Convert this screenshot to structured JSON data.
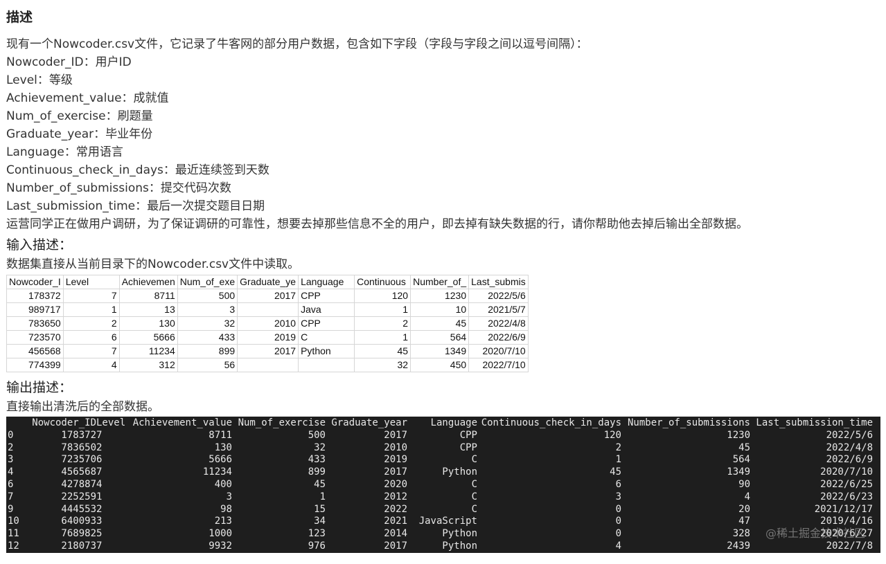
{
  "title": "描述",
  "intro": "现有一个Nowcoder.csv文件，它记录了牛客网的部分用户数据，包含如下字段（字段与字段之间以逗号间隔）：",
  "fields": [
    "Nowcoder_ID：用户ID",
    "Level：等级",
    "Achievement_value：成就值",
    "Num_of_exercise：刷题量",
    "Graduate_year：毕业年份",
    "Language：常用语言",
    "Continuous_check_in_days：最近连续签到天数",
    "Number_of_submissions：提交代码次数",
    "Last_submission_time：最后一次提交题目日期"
  ],
  "task": "运营同学正在做用户调研，为了保证调研的可靠性，想要去掉那些信息不全的用户，即去掉有缺失数据的行，请你帮助他去掉后输出全部数据。",
  "input_heading": "输入描述：",
  "input_desc": "数据集直接从当前目录下的Nowcoder.csv文件中读取。",
  "input_table": {
    "headers": [
      "Nowcoder_I",
      "Level",
      "Achievemen",
      "Num_of_exe",
      "Graduate_ye",
      "Language",
      "Continuous",
      "Number_of_",
      "Last_submis"
    ],
    "rows": [
      [
        "178372",
        "7",
        "8711",
        "500",
        "2017",
        "CPP",
        "120",
        "1230",
        "2022/5/6"
      ],
      [
        "989717",
        "1",
        "13",
        "3",
        "",
        "Java",
        "1",
        "10",
        "2021/5/7"
      ],
      [
        "783650",
        "2",
        "130",
        "32",
        "2010",
        "CPP",
        "2",
        "45",
        "2022/4/8"
      ],
      [
        "723570",
        "6",
        "5666",
        "433",
        "2019",
        "C",
        "1",
        "564",
        "2022/6/9"
      ],
      [
        "456568",
        "7",
        "11234",
        "899",
        "2017",
        "Python",
        "45",
        "1349",
        "2020/7/10"
      ],
      [
        "774399",
        "4",
        "312",
        "56",
        "",
        "",
        "32",
        "450",
        "2022/7/10"
      ]
    ]
  },
  "output_heading": "输出描述：",
  "output_desc": "直接输出清洗后的全部数据。",
  "output_table": {
    "headers": [
      "",
      "Nowcoder_ID",
      "Level",
      "Achievement_value",
      "Num_of_exercise",
      "Graduate_year",
      "Language",
      "Continuous_check_in_days",
      "Number_of_submissions",
      "Last_submission_time"
    ],
    "rows": [
      [
        "0",
        "178372",
        "7",
        "8711",
        "500",
        "2017",
        "CPP",
        "120",
        "1230",
        "2022/5/6"
      ],
      [
        "2",
        "783650",
        "2",
        "130",
        "32",
        "2010",
        "CPP",
        "2",
        "45",
        "2022/4/8"
      ],
      [
        "3",
        "723570",
        "6",
        "5666",
        "433",
        "2019",
        "C",
        "1",
        "564",
        "2022/6/9"
      ],
      [
        "4",
        "456568",
        "7",
        "11234",
        "899",
        "2017",
        "Python",
        "45",
        "1349",
        "2020/7/10"
      ],
      [
        "6",
        "427887",
        "4",
        "400",
        "45",
        "2020",
        "C",
        "6",
        "90",
        "2022/6/25"
      ],
      [
        "7",
        "225259",
        "1",
        "3",
        "1",
        "2012",
        "C",
        "3",
        "4",
        "2022/6/23"
      ],
      [
        "9",
        "444553",
        "2",
        "98",
        "15",
        "2022",
        "C",
        "0",
        "20",
        "2021/12/17"
      ],
      [
        "10",
        "640093",
        "3",
        "213",
        "34",
        "2021",
        "JavaScript",
        "0",
        "47",
        "2019/4/16"
      ],
      [
        "11",
        "768982",
        "5",
        "1000",
        "123",
        "2014",
        "Python",
        "0",
        "328",
        "2020/6/27"
      ],
      [
        "12",
        "218073",
        "7",
        "9932",
        "976",
        "2017",
        "Python",
        "4",
        "2439",
        "2022/7/8"
      ]
    ]
  },
  "watermark": "@稀土掘金技术社区"
}
